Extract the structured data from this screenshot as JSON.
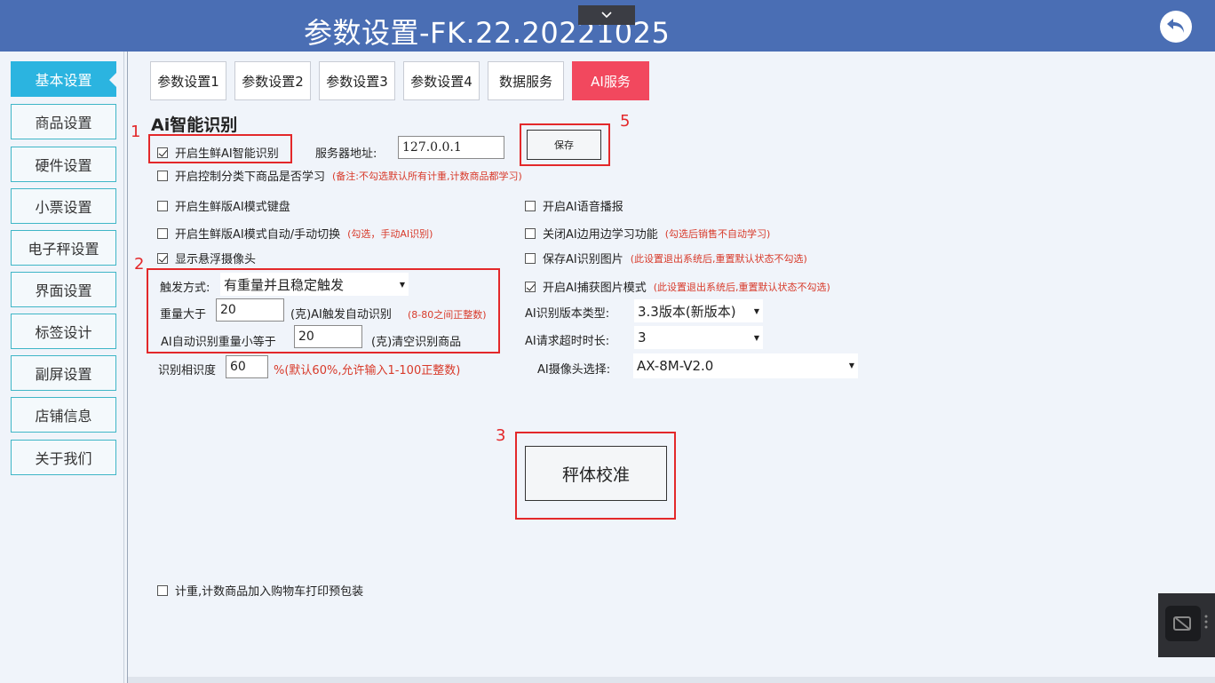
{
  "title": "参数设置-FK.22.20221025",
  "sidebar": {
    "items": [
      {
        "label": "基本设置",
        "active": true
      },
      {
        "label": "商品设置"
      },
      {
        "label": "硬件设置"
      },
      {
        "label": "小票设置"
      },
      {
        "label": "电子秤设置"
      },
      {
        "label": "界面设置"
      },
      {
        "label": "标签设计"
      },
      {
        "label": "副屏设置"
      },
      {
        "label": "店铺信息"
      },
      {
        "label": "关于我们"
      }
    ]
  },
  "tabs": [
    {
      "label": "参数设置1"
    },
    {
      "label": "参数设置2"
    },
    {
      "label": "参数设置3"
    },
    {
      "label": "参数设置4"
    },
    {
      "label": "数据服务"
    },
    {
      "label": "AI服务",
      "active": true
    }
  ],
  "section_title": "Ai智能识别",
  "markers": {
    "m1": "1",
    "m2": "2",
    "m3": "3",
    "m5": "5"
  },
  "ai": {
    "enable_fresh_ai": {
      "label": "开启生鲜AI智能识别",
      "checked": true
    },
    "server_label": "服务器地址:",
    "server_value": "127.0.0.1",
    "save_label": "保存",
    "category_learn": {
      "label": "开启控制分类下商品是否学习",
      "note": "(备注:不勾选默认所有计重,计数商品都学习)",
      "checked": false
    },
    "ai_keyboard": {
      "label": "开启生鲜版AI模式键盘",
      "checked": false
    },
    "auto_switch": {
      "label": "开启生鲜版AI模式自动/手动切换",
      "note": "(勾选，手动AI识别)",
      "checked": false
    },
    "floating_camera": {
      "label": "显示悬浮摄像头",
      "checked": true
    },
    "trigger_label": "触发方式:",
    "trigger_value": "有重量并且稳定触发",
    "weight_label": "重量大于",
    "weight_value": "20",
    "weight_suffix": "(克)AI触发自动识别",
    "weight_note": "(8-80之间正整数)",
    "clear_label": "AI自动识别重量小等于",
    "clear_value": "20",
    "clear_suffix": "(克)清空识别商品",
    "similarity_label": "识别相识度",
    "similarity_value": "60",
    "similarity_suffix": "%(默认60%,允许输入1-100正整数)",
    "voice": {
      "label": "开启AI语音播报",
      "checked": false
    },
    "close_learn": {
      "label": "关闭AI边用边学习功能",
      "note": "(勾选后销售不自动学习)",
      "checked": false
    },
    "save_images": {
      "label": "保存AI识别图片",
      "note": "(此设置退出系统后,重置默认状态不勾选)",
      "checked": false
    },
    "capture_mode": {
      "label": "开启AI捕获图片模式",
      "note": "(此设置退出系统后,重置默认状态不勾选)",
      "checked": true
    },
    "version_label": "AI识别版本类型:",
    "version_value": "3.3版本(新版本)",
    "timeout_label": "AI请求超时时长:",
    "timeout_value": "3",
    "camera_label": "AI摄像头选择:",
    "camera_value": "AX-8M-V2.0",
    "calibrate_label": "秤体校准",
    "prepack": {
      "label": "计重,计数商品加入购物车打印预包装",
      "checked": false
    }
  },
  "colors": {
    "titlebar": "#4a6eb4",
    "active_tab": "#f2485e",
    "active_side": "#2bb4e0",
    "annotation": "#e3282a"
  }
}
